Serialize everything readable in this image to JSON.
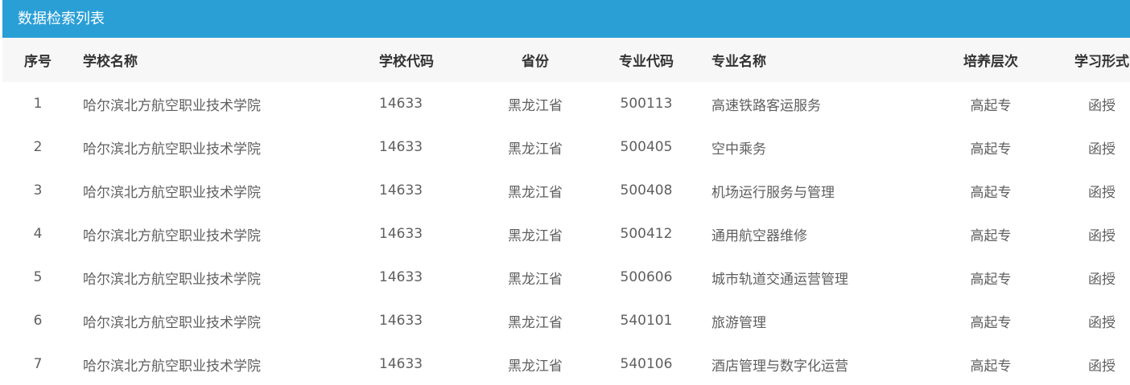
{
  "panel": {
    "title": "数据检索列表",
    "accent_color": "#2a9fd6"
  },
  "table": {
    "columns": [
      "序号",
      "学校名称",
      "学校代码",
      "省份",
      "专业代码",
      "专业名称",
      "培养层次",
      "学习形式"
    ],
    "rows": [
      [
        "1",
        "哈尔滨北方航空职业技术学院",
        "14633",
        "黑龙江省",
        "500113",
        "高速铁路客运服务",
        "高起专",
        "函授"
      ],
      [
        "2",
        "哈尔滨北方航空职业技术学院",
        "14633",
        "黑龙江省",
        "500405",
        "空中乘务",
        "高起专",
        "函授"
      ],
      [
        "3",
        "哈尔滨北方航空职业技术学院",
        "14633",
        "黑龙江省",
        "500408",
        "机场运行服务与管理",
        "高起专",
        "函授"
      ],
      [
        "4",
        "哈尔滨北方航空职业技术学院",
        "14633",
        "黑龙江省",
        "500412",
        "通用航空器维修",
        "高起专",
        "函授"
      ],
      [
        "5",
        "哈尔滨北方航空职业技术学院",
        "14633",
        "黑龙江省",
        "500606",
        "城市轨道交通运营管理",
        "高起专",
        "函授"
      ],
      [
        "6",
        "哈尔滨北方航空职业技术学院",
        "14633",
        "黑龙江省",
        "540101",
        "旅游管理",
        "高起专",
        "函授"
      ],
      [
        "7",
        "哈尔滨北方航空职业技术学院",
        "14633",
        "黑龙江省",
        "540106",
        "酒店管理与数字化运营",
        "高起专",
        "函授"
      ]
    ]
  }
}
